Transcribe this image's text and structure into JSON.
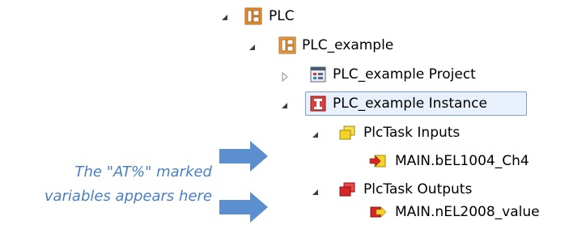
{
  "tree": {
    "plc": {
      "label": "PLC"
    },
    "plc_example": {
      "label": "PLC_example"
    },
    "project": {
      "label": "PLC_example Project"
    },
    "instance": {
      "label": "PLC_example Instance"
    },
    "plctask_inputs": {
      "label": "PlcTask Inputs"
    },
    "input_var": {
      "label": "MAIN.bEL1004_Ch4"
    },
    "plctask_outputs": {
      "label": "PlcTask Outputs"
    },
    "output_var": {
      "label": "MAIN.nEL2008_value"
    }
  },
  "annotation": {
    "line1": "The \"AT%\" marked",
    "line2": "variables appears here"
  },
  "colors": {
    "annotation": "#4a7fbf",
    "arrow": "#5b8fd0",
    "plc_icon": "#e8902a",
    "inputs_icon": "#f3d326",
    "outputs_icon": "#d42626",
    "selection_border": "#7da2ce",
    "selection_fill": "#e8f1fb"
  },
  "icons": {
    "plc": "plc-icon",
    "plc_example": "plc-project-icon",
    "project": "plc-project-file-icon",
    "instance": "plc-instance-icon",
    "inputs": "input-image-icon",
    "input_var": "input-variable-icon",
    "outputs": "output-image-icon",
    "output_var": "output-variable-icon"
  }
}
